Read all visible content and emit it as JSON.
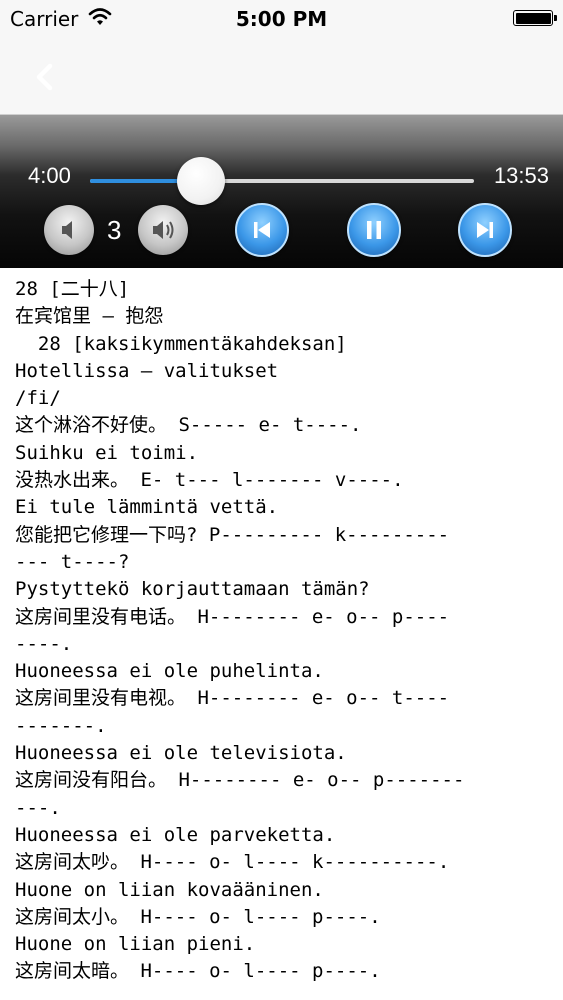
{
  "status_bar": {
    "carrier": "Carrier",
    "time": "5:00 PM"
  },
  "player": {
    "elapsed": "4:00",
    "total": "13:53",
    "progress": 0.288,
    "volume_level": "3"
  },
  "icons": {
    "wifi": "wifi-icon",
    "battery": "battery-icon",
    "back": "chevron-left-icon",
    "volume_down": "speaker-low-icon",
    "volume_up": "speaker-high-icon",
    "previous": "skip-previous-icon",
    "pause": "pause-icon",
    "next": "skip-next-icon"
  },
  "colors": {
    "accent": "#2f8fe0",
    "nav_background": "#f7f7f7",
    "player_background": "#121212"
  },
  "lesson_lines": [
    "28 [二十八]",
    "在宾馆里 — 抱怨",
    "  28 [kaksikymmentäkahdeksan]",
    "Hotellissa — valitukset",
    "/fi/",
    "这个淋浴不好使。 S----- e- t----.",
    "Suihku ei toimi.",
    "没热水出来。 E- t--- l------- v----.",
    "Ei tule lämmintä vettä.",
    "您能把它修理一下吗? P--------- k---------",
    "--- t----?",
    "Pystyttekö korjauttamaan tämän?",
    "这房间里没有电话。 H-------- e- o-- p----",
    "----.",
    "Huoneessa ei ole puhelinta.",
    "这房间里没有电视。 H-------- e- o-- t----",
    "-------.",
    "Huoneessa ei ole televisiota.",
    "这房间没有阳台。 H-------- e- o-- p-------",
    "---.",
    "Huoneessa ei ole parveketta.",
    "这房间太吵。 H---- o- l---- k----------.",
    "Huone on liian kovaääninen.",
    "这房间太小。 H---- o- l---- p----.",
    "Huone on liian pieni.",
    "这房间太暗。 H---- o- l---- p----."
  ]
}
